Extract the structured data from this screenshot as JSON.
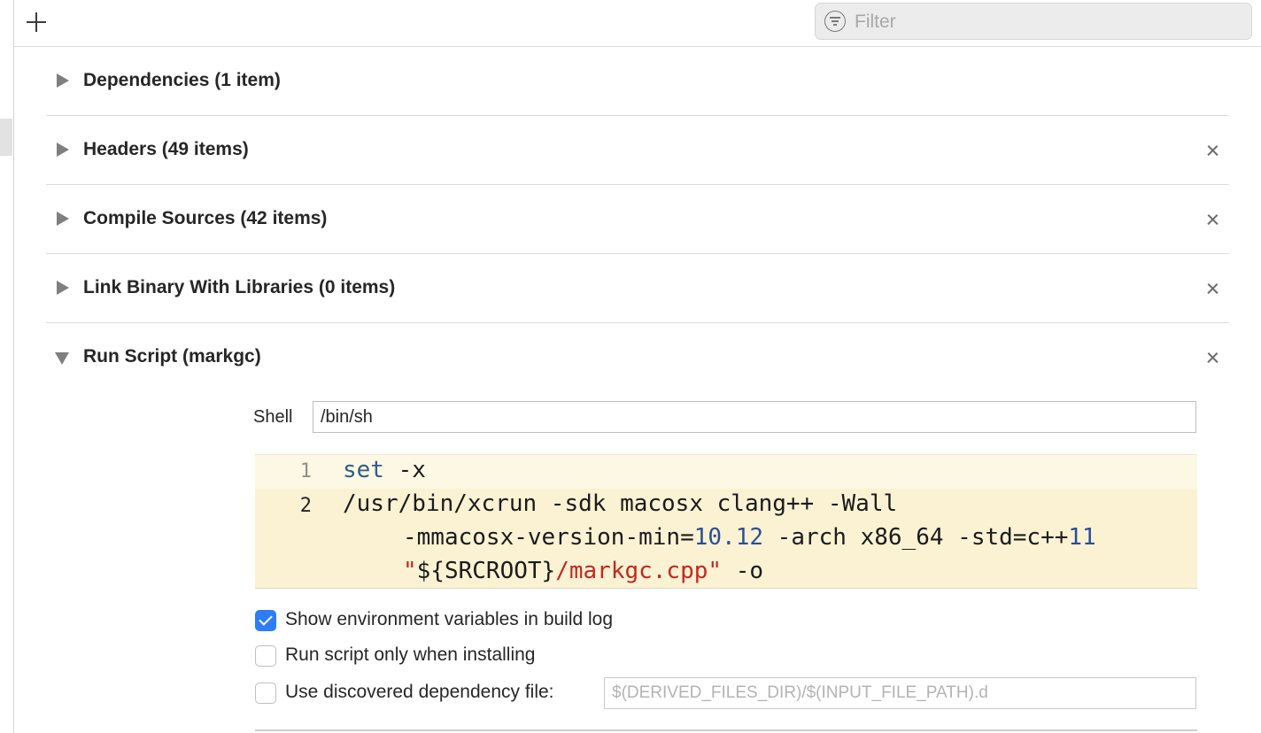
{
  "toolbar": {
    "add_icon": "plus-icon",
    "filter": {
      "placeholder": "Filter",
      "icon": "filter-icon"
    }
  },
  "phases": [
    {
      "title": "Dependencies (1 item)",
      "expanded": false,
      "removable": false
    },
    {
      "title": "Headers (49 items)",
      "expanded": false,
      "removable": true
    },
    {
      "title": "Compile Sources (42 items)",
      "expanded": false,
      "removable": true
    },
    {
      "title": "Link Binary With Libraries (0 items)",
      "expanded": false,
      "removable": true
    },
    {
      "title": "Run Script (markgc)",
      "expanded": true,
      "removable": true
    }
  ],
  "run_script": {
    "shell_label": "Shell",
    "shell_value": "/bin/sh",
    "script_lines": [
      {
        "number": "1",
        "text": "set -x"
      },
      {
        "number": "2",
        "text": "/usr/bin/xcrun -sdk macosx clang++ -Wall -mmacosx-version-min=10.12 -arch x86_64 -std=c++11 \"${SRCROOT}/markgc.cpp\" -o"
      }
    ],
    "options": [
      {
        "label": "Show environment variables in build log",
        "checked": true
      },
      {
        "label": "Run script only when installing",
        "checked": false
      },
      {
        "label": "Use discovered dependency file:",
        "checked": false
      }
    ],
    "dependency_file_placeholder": "$(DERIVED_FILES_DIR)/$(INPUT_FILE_PATH).d"
  },
  "colors": {
    "accent": "#2e7cf6",
    "editor_background": "#fdf8e3",
    "string": "#c2281e",
    "keyword": "#2f5d8a"
  }
}
